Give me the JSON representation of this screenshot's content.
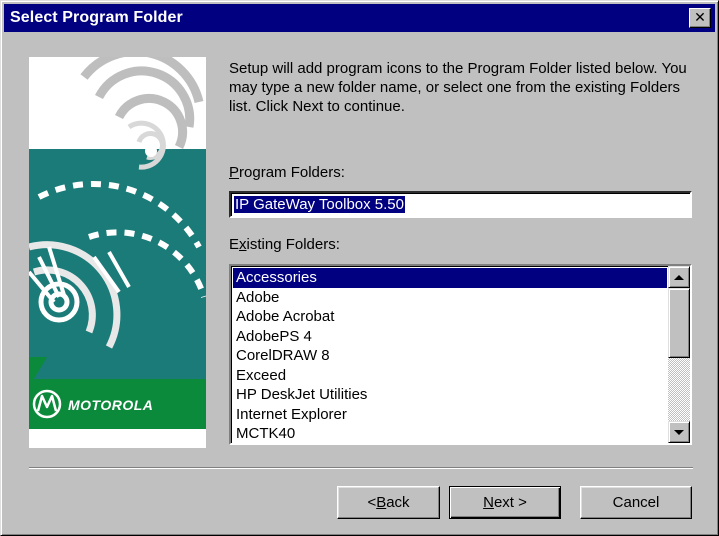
{
  "window": {
    "title": "Select Program Folder",
    "close_glyph": "✕"
  },
  "description": "Setup will add program icons to the Program Folder listed below. You may type a new folder name, or select one from the existing Folders list.  Click Next to continue.",
  "program_folders": {
    "label_key": "P",
    "label_rest": "rogram Folders:",
    "value": "IP GateWay Toolbox 5.50"
  },
  "existing_folders": {
    "label_pre": "E",
    "label_key": "x",
    "label_rest": "isting Folders:",
    "items": [
      {
        "label": "Accessories",
        "selected": true
      },
      {
        "label": "Adobe"
      },
      {
        "label": "Adobe Acrobat"
      },
      {
        "label": "AdobePS 4"
      },
      {
        "label": "CorelDRAW 8"
      },
      {
        "label": "Exceed"
      },
      {
        "label": "HP DeskJet Utilities"
      },
      {
        "label": "Internet Explorer"
      },
      {
        "label": "MCTK40"
      }
    ],
    "scroll_position": 0
  },
  "banner": {
    "brand": "MOTOROLA",
    "colors": {
      "teal": "#1a7b78",
      "green": "#0a8a3a",
      "white": "#ffffff"
    }
  },
  "buttons": {
    "back_pre": "< ",
    "back_key": "B",
    "back_rest": "ack",
    "next_key": "N",
    "next_rest": "ext >",
    "cancel": "Cancel"
  }
}
